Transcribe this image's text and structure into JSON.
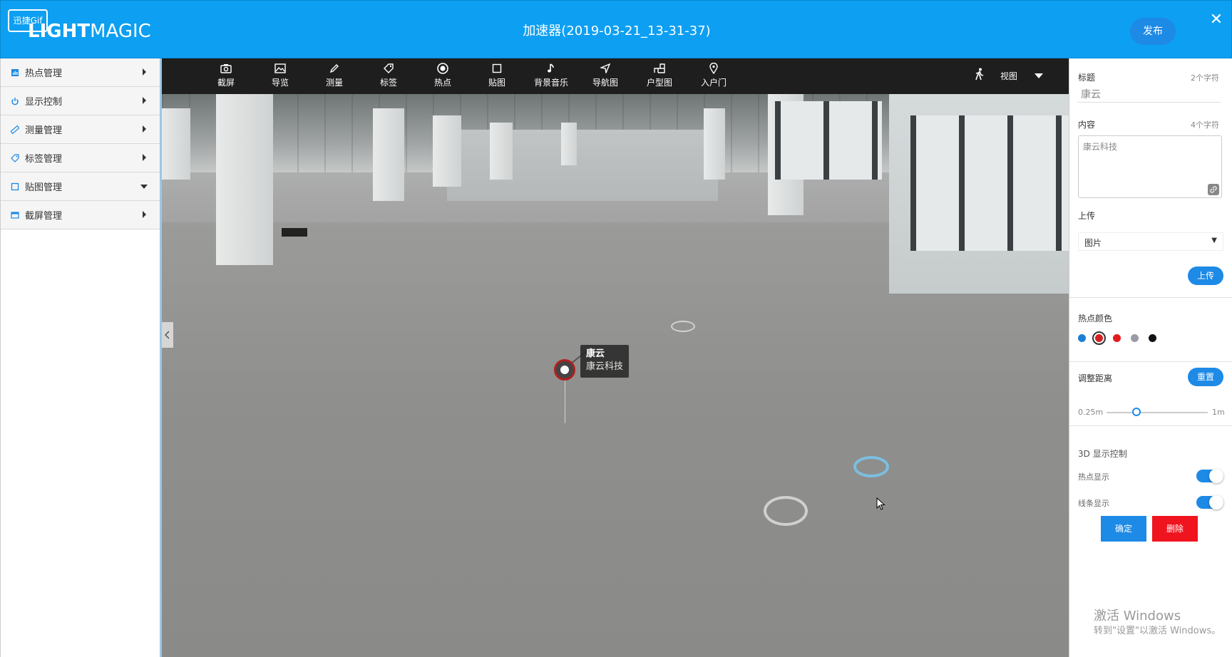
{
  "header": {
    "logo_badge": "迅捷Gif",
    "logo_bold": "LIGHT",
    "logo_light": "MAGIC",
    "title": "加速器(2019-03-21_13-31-37)",
    "publish_label": "发布",
    "close_glyph": "✕"
  },
  "sidebar": {
    "items": [
      {
        "label": "热点管理",
        "icon": "chart-icon",
        "expanded": false
      },
      {
        "label": "显示控制",
        "icon": "power-icon",
        "expanded": false
      },
      {
        "label": "测量管理",
        "icon": "ruler-icon",
        "expanded": false
      },
      {
        "label": "标签管理",
        "icon": "tag-icon",
        "expanded": false
      },
      {
        "label": "贴图管理",
        "icon": "square-icon",
        "expanded": true
      },
      {
        "label": "截屏管理",
        "icon": "screen-icon",
        "expanded": false
      }
    ]
  },
  "toolbar": {
    "tools": [
      {
        "label": "截屏",
        "icon": "camera-icon"
      },
      {
        "label": "导览",
        "icon": "image-icon"
      },
      {
        "label": "测量",
        "icon": "pencil-icon"
      },
      {
        "label": "标签",
        "icon": "tag-icon"
      },
      {
        "label": "热点",
        "icon": "target-icon"
      },
      {
        "label": "贴图",
        "icon": "square-icon"
      },
      {
        "label": "背景音乐",
        "icon": "music-icon"
      },
      {
        "label": "导航图",
        "icon": "navigation-icon"
      },
      {
        "label": "户型图",
        "icon": "floorplan-icon"
      },
      {
        "label": "入户门",
        "icon": "location-pin-icon"
      }
    ],
    "view_label": "视图"
  },
  "hotspot": {
    "title": "康云",
    "content": "康云科技",
    "color": "#b02020"
  },
  "panel": {
    "title_label": "标题",
    "title_count": "2个字符",
    "title_value": "康云",
    "content_label": "内容",
    "content_count": "4个字符",
    "content_value": "康云科技",
    "upload_label": "上传",
    "upload_select": "图片",
    "upload_button": "上传",
    "color_label": "热点颜色",
    "colors": [
      "#1a7fd4",
      "#d42020",
      "#e31b1b",
      "#9a9aa8",
      "#111111"
    ],
    "selected_color_index": 1,
    "distance_label": "调整距离",
    "reset_button": "重置",
    "distance_min": "0.25m",
    "distance_max": "1m",
    "distance_value": 0.4,
    "display_label": "3D 显示控制",
    "hotspot_display_label": "热点显示",
    "hotspot_display_on": true,
    "line_display_label": "线条显示",
    "line_display_on": true,
    "confirm_button": "确定",
    "delete_button": "删除"
  },
  "watermark": {
    "line1": "激活 Windows",
    "line2": "转到\"设置\"以激活 Windows。"
  }
}
